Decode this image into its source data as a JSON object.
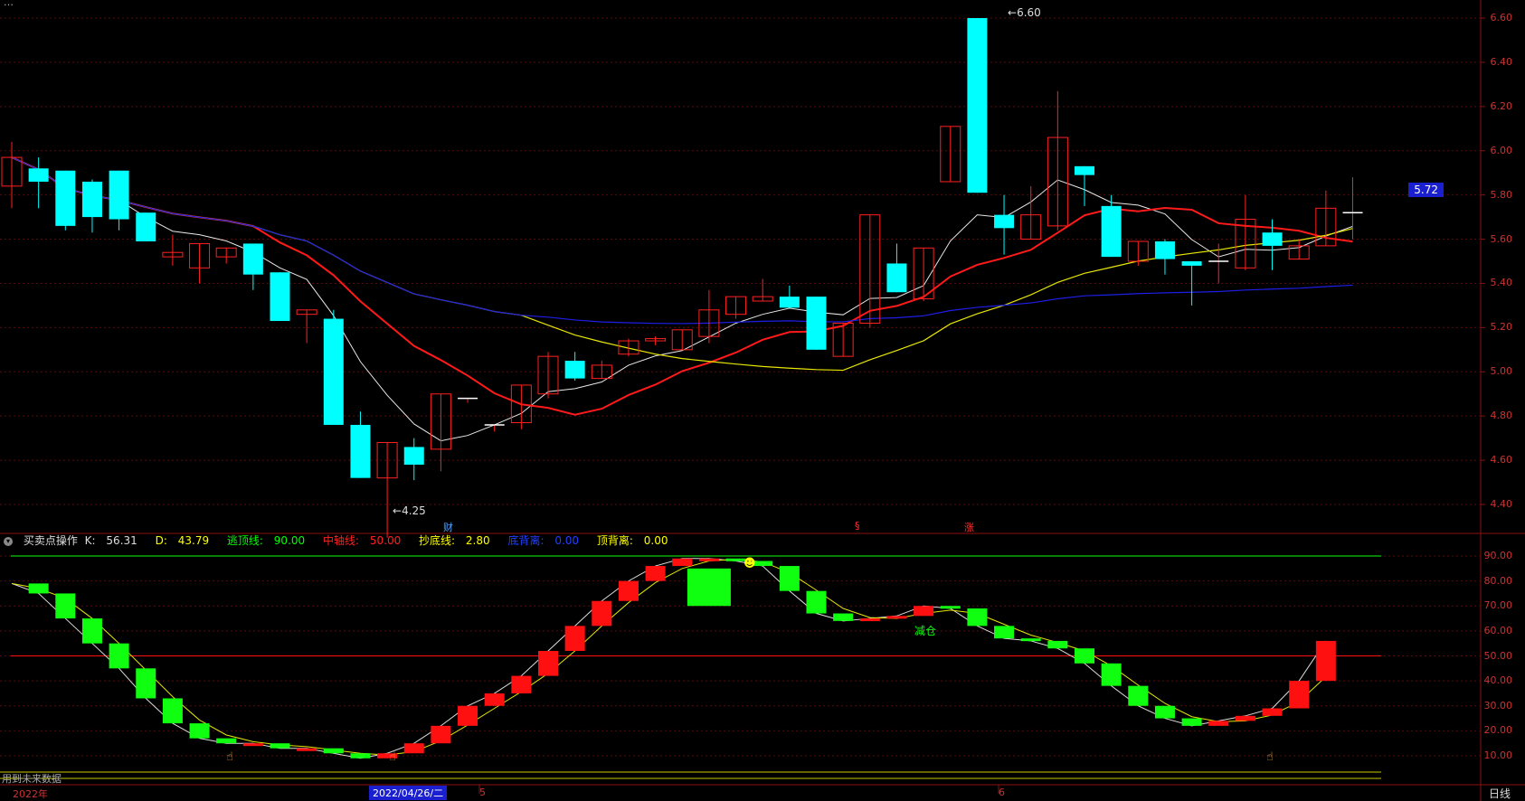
{
  "top_title": {
    "text": "…"
  },
  "price": {
    "high_label": "6.60",
    "low_label": "4.25",
    "current_tag": "5.72",
    "axis_labels": [
      "6.60",
      "6.40",
      "6.20",
      "6.00",
      "5.80",
      "5.60",
      "5.40",
      "5.20",
      "5.00",
      "4.80",
      "4.60",
      "4.40"
    ],
    "markers": {
      "cai": "财",
      "s": "§",
      "zhang": "涨"
    },
    "colors": {
      "up": "#ff2020",
      "down": "#00ffff",
      "ma5": "#e8e8e8",
      "ma10": "#ff1a1a",
      "ma20": "#e6e600",
      "ma60": "#1e1ee6"
    }
  },
  "indicator": {
    "name": "买卖点操作",
    "k_label": "K:",
    "k_value": "56.31",
    "d_label": "D:",
    "d_value": "43.79",
    "top_label": "逃顶线:",
    "top_value": "90.00",
    "mid_label": "中轴线:",
    "mid_value": "50.00",
    "bottom_label": "抄底线:",
    "bottom_value": "2.80",
    "div_low_label": "底背离:",
    "div_low_value": "0.00",
    "div_top_label": "顶背离:",
    "div_top_value": "0.00",
    "axis_labels": [
      "90.00",
      "80.00",
      "70.00",
      "60.00",
      "50.00",
      "40.00",
      "30.00",
      "20.00",
      "10.00"
    ],
    "annotation_reduce": "减仓",
    "annotation_sell": "卖",
    "colors": {
      "rise": "#ff1010",
      "fall": "#10ff10",
      "top_line": "#10ff10",
      "mid_line": "#ff1010"
    }
  },
  "footer": {
    "note": "用到未来数据",
    "year": "2022年",
    "date_tag": "2022/04/26/二",
    "month5": "5",
    "month6": "6",
    "period": "日线"
  },
  "chart_data": [
    {
      "type": "candlestick",
      "ylim": [
        4.25,
        6.6
      ],
      "candles": [
        [
          5.84,
          6.04,
          5.97,
          5.74
        ],
        [
          5.92,
          5.97,
          5.86,
          5.74
        ],
        [
          5.91,
          5.91,
          5.66,
          5.64
        ],
        [
          5.86,
          5.87,
          5.7,
          5.63
        ],
        [
          5.91,
          5.91,
          5.69,
          5.64
        ],
        [
          5.72,
          5.72,
          5.59,
          5.59
        ],
        [
          5.52,
          5.62,
          5.54,
          5.48
        ],
        [
          5.47,
          5.58,
          5.58,
          5.4
        ],
        [
          5.52,
          5.56,
          5.56,
          5.49
        ],
        [
          5.58,
          5.58,
          5.44,
          5.37
        ],
        [
          5.45,
          5.45,
          5.23,
          5.23
        ],
        [
          5.26,
          5.28,
          5.28,
          5.13
        ],
        [
          5.24,
          5.28,
          4.76,
          4.76
        ],
        [
          4.76,
          4.82,
          4.52,
          4.52
        ],
        [
          4.52,
          4.68,
          4.68,
          4.25
        ],
        [
          4.66,
          4.7,
          4.58,
          4.51
        ],
        [
          4.65,
          4.9,
          4.9,
          4.55
        ],
        [
          4.88,
          4.88,
          4.88,
          4.86
        ],
        [
          4.76,
          4.76,
          4.76,
          4.73
        ],
        [
          4.77,
          4.94,
          4.94,
          4.74
        ],
        [
          4.9,
          5.09,
          5.07,
          4.88
        ],
        [
          5.05,
          5.09,
          4.97,
          4.96
        ],
        [
          4.97,
          5.05,
          5.03,
          4.97
        ],
        [
          5.08,
          5.15,
          5.14,
          5.07
        ],
        [
          5.14,
          5.16,
          5.15,
          5.12
        ],
        [
          5.1,
          5.19,
          5.19,
          5.1
        ],
        [
          5.16,
          5.37,
          5.28,
          5.13
        ],
        [
          5.26,
          5.34,
          5.34,
          5.24
        ],
        [
          5.32,
          5.42,
          5.34,
          5.32
        ],
        [
          5.34,
          5.39,
          5.29,
          5.29
        ],
        [
          5.34,
          5.34,
          5.1,
          5.1
        ],
        [
          5.07,
          5.22,
          5.22,
          5.07
        ],
        [
          5.22,
          5.71,
          5.71,
          5.2
        ],
        [
          5.49,
          5.58,
          5.36,
          5.36
        ],
        [
          5.33,
          5.56,
          5.56,
          5.32
        ],
        [
          5.86,
          6.11,
          6.11,
          5.86
        ],
        [
          6.6,
          6.6,
          5.81,
          5.81
        ],
        [
          5.71,
          5.8,
          5.65,
          5.53
        ],
        [
          5.6,
          5.84,
          5.71,
          5.6
        ],
        [
          5.66,
          6.27,
          6.06,
          5.64
        ],
        [
          5.93,
          5.93,
          5.89,
          5.75
        ],
        [
          5.75,
          5.8,
          5.52,
          5.52
        ],
        [
          5.5,
          5.59,
          5.59,
          5.48
        ],
        [
          5.59,
          5.6,
          5.51,
          5.44
        ],
        [
          5.5,
          5.5,
          5.48,
          5.3
        ],
        [
          5.5,
          5.58,
          5.5,
          5.4
        ],
        [
          5.47,
          5.8,
          5.69,
          5.46
        ],
        [
          5.63,
          5.69,
          5.57,
          5.46
        ],
        [
          5.51,
          5.6,
          5.57,
          5.51
        ],
        [
          5.57,
          5.82,
          5.74,
          5.57
        ],
        [
          5.72,
          5.88,
          5.72,
          5.6
        ]
      ]
    },
    {
      "type": "bar",
      "ylim": [
        0,
        100
      ],
      "values": [
        79,
        75,
        65,
        55,
        45,
        33,
        23,
        17,
        15,
        15,
        13,
        13,
        11,
        9,
        11,
        15,
        22,
        30,
        35,
        42,
        52,
        62,
        72,
        80,
        86,
        89,
        89,
        88,
        86,
        76,
        67,
        64,
        65,
        66,
        70,
        69,
        62,
        57,
        56,
        53,
        47,
        38,
        30,
        25,
        22,
        24,
        26,
        29,
        40,
        56
      ]
    }
  ]
}
